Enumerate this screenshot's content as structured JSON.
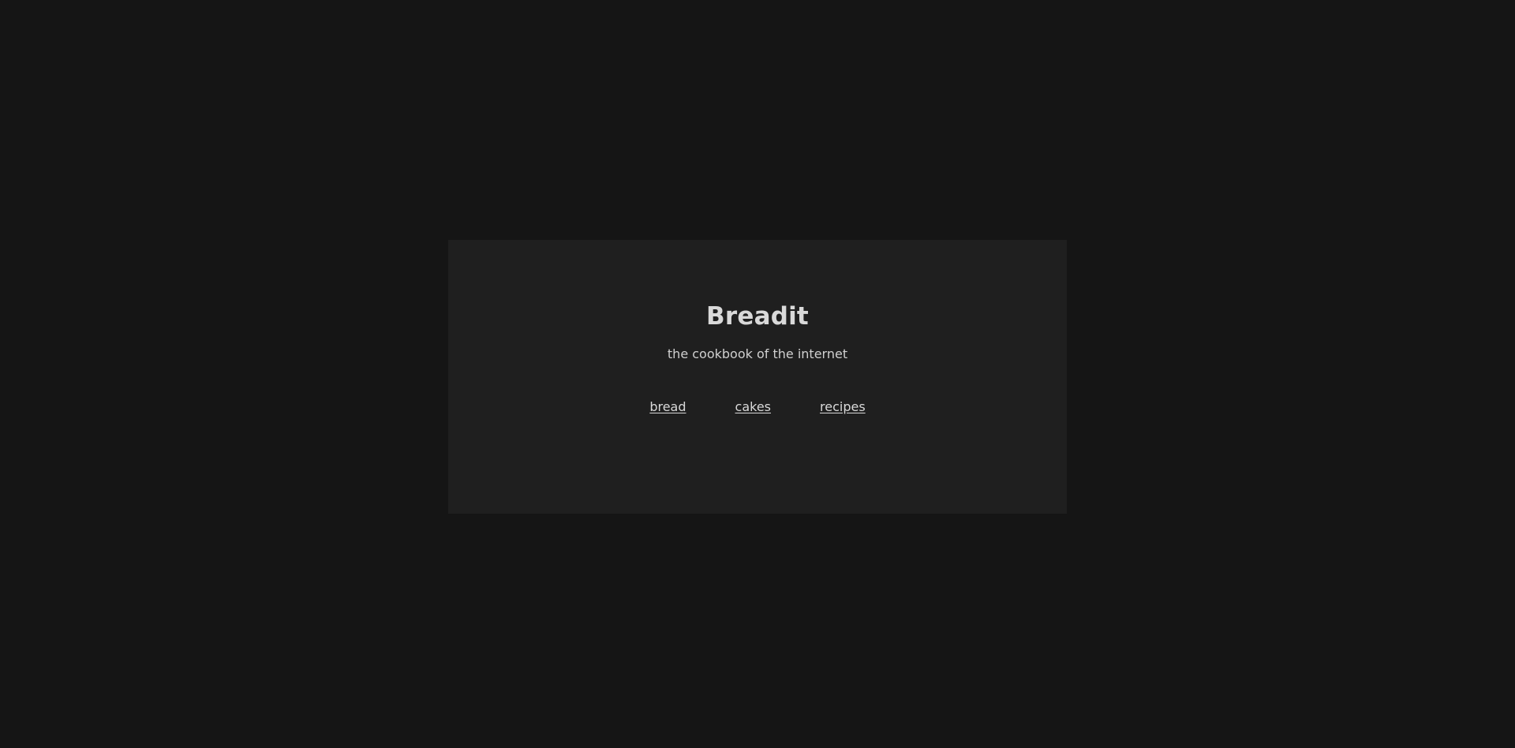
{
  "site": {
    "title": "Breadit",
    "tagline": "the cookbook of the internet"
  },
  "nav": {
    "items": [
      {
        "label": "bread"
      },
      {
        "label": "cakes"
      },
      {
        "label": "recipes"
      }
    ]
  },
  "colors": {
    "background": "#151515",
    "card": "#1f1f1f",
    "text": "#d9d9d9"
  }
}
